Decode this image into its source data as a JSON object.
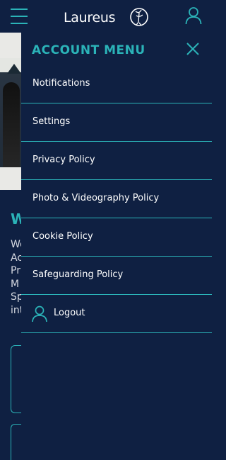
{
  "header": {
    "logo_text": "Laureus",
    "menu_icon": "hamburger-icon",
    "account_icon": "user-icon"
  },
  "background_page": {
    "heading_fragment": "W",
    "text_lines": [
      "We",
      "Ac",
      "Pr",
      "M",
      "Sp",
      "int"
    ]
  },
  "drawer": {
    "title": "ACCOUNT MENU",
    "close_icon": "close-icon",
    "items": [
      {
        "label": "Notifications"
      },
      {
        "label": "Settings"
      },
      {
        "label": "Privacy Policy"
      },
      {
        "label": "Photo & Videography Policy"
      },
      {
        "label": "Cookie Policy"
      },
      {
        "label": "Safeguarding Policy"
      },
      {
        "label": "Logout",
        "icon": "user-icon"
      }
    ]
  },
  "colors": {
    "background": "#0f2042",
    "accent": "#2bb3b8",
    "text": "#ffffff"
  }
}
